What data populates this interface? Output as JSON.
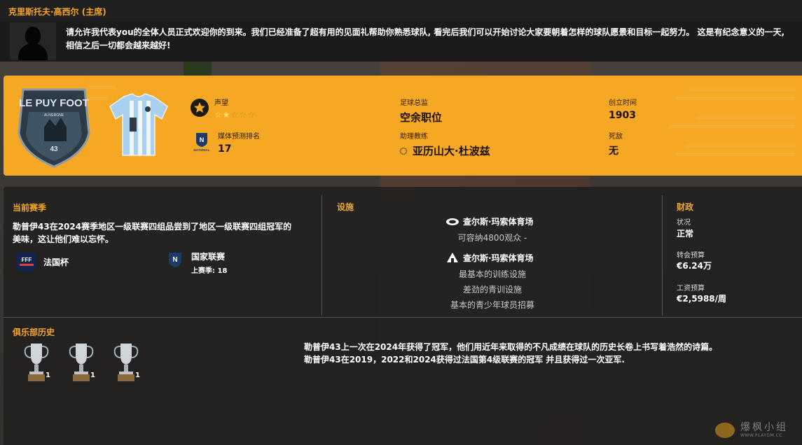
{
  "message": {
    "sender": "克里斯托夫·高西尔 (主席)",
    "text": "请允许我代表you的全体人员正式欢迎你的到来。我们已经准备了超有用的见面礼帮助你熟悉球队, 看完后我们可以开始讨论大家要朝着怎样的球队愿景和目标一起努力。 这是有纪念意义的一天, 相信之后一切都会越来越好!"
  },
  "club": {
    "crest_text": "LE PUY FOOT",
    "crest_sub": "AUVERGNE",
    "crest_num": "43",
    "reputation_label": "声望",
    "reputation_stars": 1.5,
    "reputation_max": 5,
    "media_rank_label": "媒体预测排名",
    "media_rank_value": "17",
    "league_logo_text": "NATIONAL",
    "director_label": "足球总监",
    "director_value": "空余职位",
    "assistant_label": "助理教练",
    "assistant_value": "亚历山大·杜波兹",
    "founded_label": "创立时间",
    "founded_value": "1903",
    "rival_label": "死敌",
    "rival_value": "无"
  },
  "season": {
    "title": "当前赛季",
    "text": "勒普伊43在2024赛季地区一级联赛四组品尝到了地区一级联赛四组冠军的美味，这让他们难以忘怀。",
    "cup_logo_text": "FFF",
    "cup_label": "法国杯",
    "league_label": "国家联赛",
    "league_last": "上赛季: 18"
  },
  "facilities": {
    "title": "设施",
    "stadium_name": "查尔斯·玛索体育场",
    "stadium_capacity": "可容纳4800观众 -",
    "training_name": "查尔斯·玛索体育场",
    "training_quality": "最基本的训练设施",
    "youth_facilities": "差劲的青训设施",
    "youth_recruitment": "基本的青少年球员招募"
  },
  "finance": {
    "title": "财政",
    "status_label": "状况",
    "status_value": "正常",
    "transfer_label": "转会预算",
    "transfer_value": "€6.24万",
    "wage_label": "工资预算",
    "wage_value": "€2,5988/周"
  },
  "history": {
    "title": "俱乐部历史",
    "trophies": [
      {
        "count": "1"
      },
      {
        "count": "1"
      },
      {
        "count": "1"
      }
    ],
    "text_line1": "勒普伊43上一次在2024年获得了冠军，他们用近年来取得的不凡成绩在球队的历史长卷上书写着浩然的诗篇。",
    "text_line2": "勒普伊43在2019，2022和2024获得过法国第4级联赛的冠军 并且获得过一次亚军."
  },
  "watermark": {
    "main": "爆枫小组",
    "sub": "WWW.PLAYGM.CC"
  },
  "colors": {
    "accent": "#f5a623",
    "panel_orange": "#f5a823",
    "dark_panel": "#222120",
    "kit_blue": "#9cc8e8"
  }
}
